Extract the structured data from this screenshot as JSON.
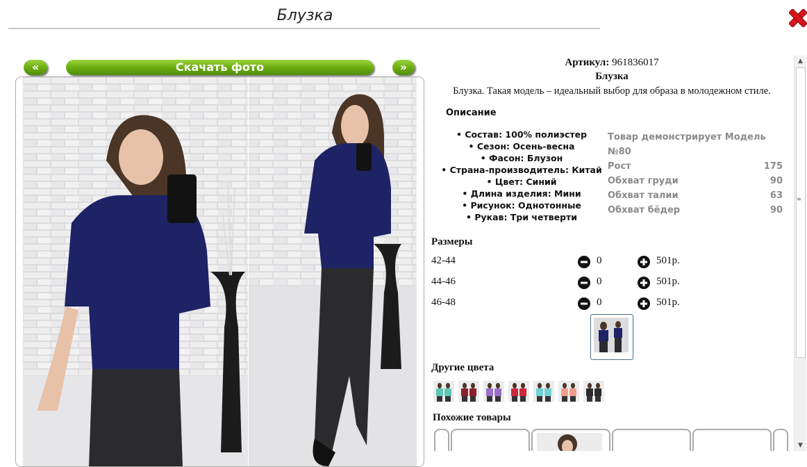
{
  "modal": {
    "title": "Блузка"
  },
  "nav": {
    "prev_label": "«",
    "download_label": "Скачать фото",
    "next_label": "»"
  },
  "product": {
    "article_label": "Артикул:",
    "article_value": "961836017",
    "name": "Блузка",
    "tagline": "Блузка. Такая модель – идеальный выбор для образа в молодежном стиле."
  },
  "description": {
    "heading": "Описание",
    "properties": [
      "Состав: 100% полиэстер",
      "Сезон: Осень-весна",
      "Фасон: Блузон",
      "Страна-производитель: Китай",
      "Цвет: Синий",
      "Длина изделия: Мини",
      "Рисунок: Однотонные",
      "Рукав: Три четверти"
    ]
  },
  "model": {
    "title": "Товар демонстрирует Модель №80",
    "rows": [
      {
        "label": "Рост",
        "value": "175"
      },
      {
        "label": "Обхват груди",
        "value": "90"
      },
      {
        "label": "Обхват талии",
        "value": "63"
      },
      {
        "label": "Обхват бёдер",
        "value": "90"
      }
    ]
  },
  "sizes": {
    "heading": "Размеры",
    "rows": [
      {
        "size": "42-44",
        "qty": "0",
        "price": "501р."
      },
      {
        "size": "44-46",
        "qty": "0",
        "price": "501р."
      },
      {
        "size": "46-48",
        "qty": "0",
        "price": "501р."
      }
    ]
  },
  "other_colors": {
    "heading": "Другие цвета",
    "swatches": [
      "#5fc7b6",
      "#8c1f2a",
      "#9a6fc9",
      "#d0283a",
      "#6fd0d4",
      "#f0a08a",
      "#2a2a2a"
    ]
  },
  "similar": {
    "heading": "Похожие товары"
  },
  "colors": {
    "accent_green": "#6aaa10",
    "blouse_navy": "#1e2366",
    "close_red": "#d8141c"
  }
}
